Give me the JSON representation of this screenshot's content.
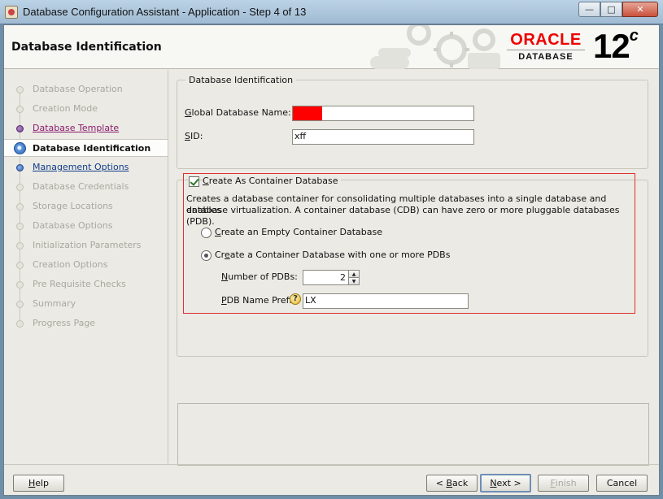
{
  "window": {
    "title": "Database Configuration Assistant - Application - Step 4 of 13",
    "minimize_glyph": "—",
    "maximize_glyph": "□",
    "close_glyph": "✕"
  },
  "header": {
    "title": "Database Identification",
    "logo_word": "ORACLE",
    "logo_sub": "DATABASE",
    "version": "12",
    "version_suffix": "c"
  },
  "nav": {
    "items": [
      {
        "label": "Database Operation",
        "state": "disabled"
      },
      {
        "label": "Creation Mode",
        "state": "disabled"
      },
      {
        "label": "Database Template",
        "state": "visited"
      },
      {
        "label": "Database Identification",
        "state": "current"
      },
      {
        "label": "Management Options",
        "state": "link"
      },
      {
        "label": "Database Credentials",
        "state": "disabled"
      },
      {
        "label": "Storage Locations",
        "state": "disabled"
      },
      {
        "label": "Database Options",
        "state": "disabled"
      },
      {
        "label": "Initialization Parameters",
        "state": "disabled"
      },
      {
        "label": "Creation Options",
        "state": "disabled"
      },
      {
        "label": "Pre Requisite Checks",
        "state": "disabled"
      },
      {
        "label": "Summary",
        "state": "disabled"
      },
      {
        "label": "Progress Page",
        "state": "disabled"
      }
    ]
  },
  "identification": {
    "legend": "Database Identification",
    "global_name_label_mnemonic": "G",
    "global_name_label_rest": "lobal Database Name:",
    "sid_label_mnemonic": "S",
    "sid_label_rest": "ID:",
    "sid_value": "xff"
  },
  "container": {
    "checkbox_mnemonic": "C",
    "checkbox_label_rest": "reate As Container Database",
    "checked": true,
    "description_line1": "Creates a database container for consolidating multiple databases into a single database and enables",
    "description_line2": "database virtualization. A container database (CDB) can have zero or more pluggable databases (PDB).",
    "radio_empty_mnemonic": "C",
    "radio_empty_label_rest": "reate an Empty Container Database",
    "radio_pdbs_label_start": "Cr",
    "radio_pdbs_mnemonic": "e",
    "radio_pdbs_label_rest": "ate a Container Database with one or more PDBs",
    "selected_option": "with_pdbs",
    "num_pdbs_mnemonic": "N",
    "num_pdbs_label_rest": "umber of PDBs:",
    "num_pdbs_value": "2",
    "pdb_prefix_mnemonic": "P",
    "pdb_prefix_label_rest": "DB Name Prefix:",
    "pdb_prefix_value": "LX"
  },
  "buttons": {
    "help_mnemonic": "H",
    "help_rest": "elp",
    "back_prefix": "< ",
    "back_mnemonic": "B",
    "back_rest": "ack",
    "next_mnemonic": "N",
    "next_rest": "ext >",
    "finish_mnemonic": "F",
    "finish_rest": "inish",
    "cancel": "Cancel"
  },
  "colors": {
    "oracle_red": "#e00000",
    "redaction": "#ff0000",
    "highlight_border": "#e03030",
    "visited_link": "#8b1a6e",
    "link": "#123d8b"
  }
}
